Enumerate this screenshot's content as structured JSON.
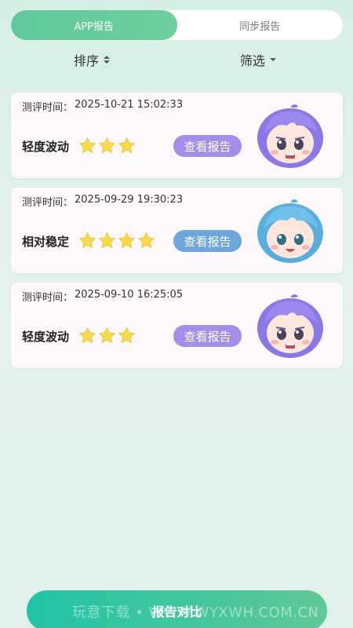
{
  "tabs": [
    {
      "label": "APP报告",
      "active": true
    },
    {
      "label": "同步报告",
      "active": false
    }
  ],
  "filters": {
    "sort_label": "排序",
    "screen_label": "筛选"
  },
  "cards": [
    {
      "time_label": "测评时间：",
      "time_value": "2025-10-21 15:02:33",
      "status": "轻度波动",
      "stars": 3,
      "button_label": "查看报告",
      "button_color": "#a58ee8",
      "avatar": "purple-hair-worried-girl"
    },
    {
      "time_label": "测评时间：",
      "time_value": "2025-09-29 19:30:23",
      "status": "相对稳定",
      "stars": 4,
      "button_label": "查看报告",
      "button_color": "#6ea6dc",
      "avatar": "blue-hair-smiling-girl"
    },
    {
      "time_label": "测评时间：",
      "time_value": "2025-09-10 16:25:05",
      "status": "轻度波动",
      "stars": 3,
      "button_label": "查看报告",
      "button_color": "#a58ee8",
      "avatar": "purple-hair-worried-girl"
    }
  ],
  "bottom_button": {
    "label": "报告对比"
  },
  "watermark": "玩意下载 • WWW.WYXWH.COM.CN",
  "colors": {
    "accent_green": "#5ec89b",
    "purple_button": "#a58ee8",
    "blue_button": "#6ea6dc",
    "star": "#f7d94c"
  }
}
